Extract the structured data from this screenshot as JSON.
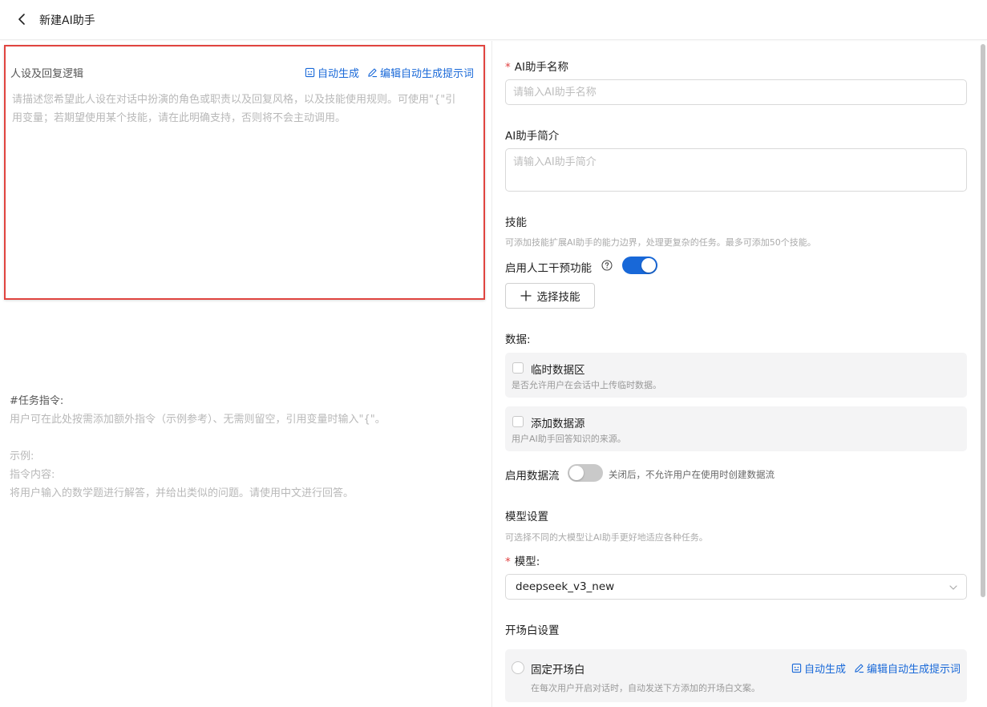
{
  "header": {
    "title": "新建AI助手"
  },
  "persona": {
    "title": "人设及回复逻辑",
    "auto_generate": "自动生成",
    "edit_prompt": "编辑自动生成提示词",
    "placeholder": "请描述您希望此人设在对话中扮演的角色或职责以及回复风格，以及技能使用规则。可使用\"{\"引用变量；若期望使用某个技能，请在此明确支持，否则将不会主动调用。"
  },
  "task": {
    "title": "#任务指令:",
    "line1": "用户可在此处按需添加额外指令（示例参考）、无需则留空，引用变量时输入\"{\"。",
    "line2": "示例:",
    "line3": "指令内容:",
    "line4": "将用户输入的数学题进行解答，并给出类似的问题。请使用中文进行回答。"
  },
  "form": {
    "name": {
      "required_mark": "*",
      "label": "AI助手名称",
      "placeholder": "请输入AI助手名称"
    },
    "intro": {
      "label": "AI助手简介",
      "placeholder": "请输入AI助手简介"
    },
    "skills": {
      "label": "技能",
      "hint": "可添加技能扩展AI助手的能力边界，处理更复杂的任务。最多可添加50个技能。",
      "human_intervention_label": "启用人工干预功能",
      "human_intervention_on": true,
      "select_button": "选择技能"
    },
    "data": {
      "label": "数据:",
      "temp_title": "临时数据区",
      "temp_desc": "是否允许用户在会话中上传临时数据。",
      "source_title": "添加数据源",
      "source_desc": "用户AI助手回答知识的来源。"
    },
    "dataflow": {
      "label": "启用数据流",
      "on": false,
      "hint": "关闭后，不允许用户在使用时创建数据流"
    },
    "model": {
      "section": "模型设置",
      "hint": "可选择不同的大模型让AI助手更好地适应各种任务。",
      "required_mark": "*",
      "label": "模型:",
      "value": "deepseek_v3_new"
    },
    "opening": {
      "section": "开场白设置",
      "fixed_title": "固定开场白",
      "auto_generate": "自动生成",
      "edit_prompt": "编辑自动生成提示词",
      "desc": "在每次用户开启对话时，自动发送下方添加的开场白文案。"
    }
  },
  "colors": {
    "accent": "#1868d8",
    "highlight_border": "#e0443f",
    "required": "#e04040"
  }
}
